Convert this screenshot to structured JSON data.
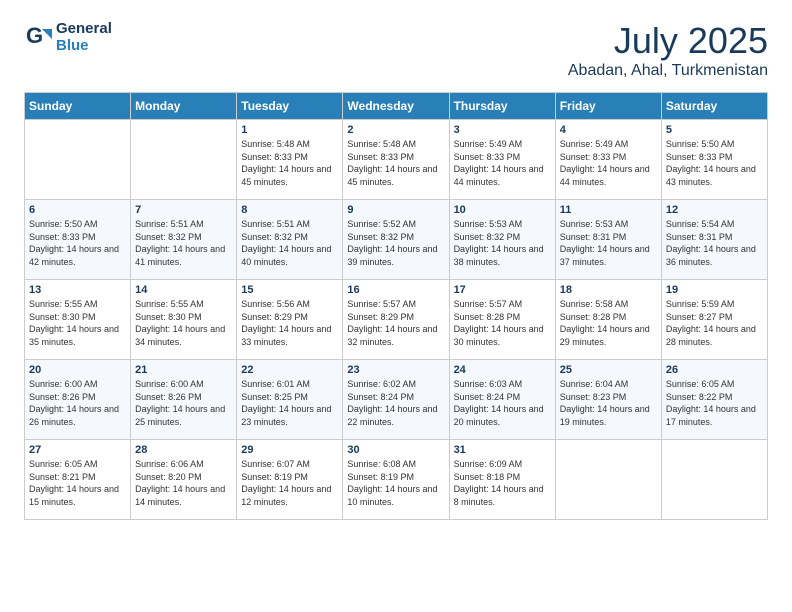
{
  "header": {
    "logo_line1": "General",
    "logo_line2": "Blue",
    "month": "July 2025",
    "location": "Abadan, Ahal, Turkmenistan"
  },
  "days_of_week": [
    "Sunday",
    "Monday",
    "Tuesday",
    "Wednesday",
    "Thursday",
    "Friday",
    "Saturday"
  ],
  "weeks": [
    [
      {
        "day": "",
        "info": ""
      },
      {
        "day": "",
        "info": ""
      },
      {
        "day": "1",
        "info": "Sunrise: 5:48 AM\nSunset: 8:33 PM\nDaylight: 14 hours and 45 minutes."
      },
      {
        "day": "2",
        "info": "Sunrise: 5:48 AM\nSunset: 8:33 PM\nDaylight: 14 hours and 45 minutes."
      },
      {
        "day": "3",
        "info": "Sunrise: 5:49 AM\nSunset: 8:33 PM\nDaylight: 14 hours and 44 minutes."
      },
      {
        "day": "4",
        "info": "Sunrise: 5:49 AM\nSunset: 8:33 PM\nDaylight: 14 hours and 44 minutes."
      },
      {
        "day": "5",
        "info": "Sunrise: 5:50 AM\nSunset: 8:33 PM\nDaylight: 14 hours and 43 minutes."
      }
    ],
    [
      {
        "day": "6",
        "info": "Sunrise: 5:50 AM\nSunset: 8:33 PM\nDaylight: 14 hours and 42 minutes."
      },
      {
        "day": "7",
        "info": "Sunrise: 5:51 AM\nSunset: 8:32 PM\nDaylight: 14 hours and 41 minutes."
      },
      {
        "day": "8",
        "info": "Sunrise: 5:51 AM\nSunset: 8:32 PM\nDaylight: 14 hours and 40 minutes."
      },
      {
        "day": "9",
        "info": "Sunrise: 5:52 AM\nSunset: 8:32 PM\nDaylight: 14 hours and 39 minutes."
      },
      {
        "day": "10",
        "info": "Sunrise: 5:53 AM\nSunset: 8:32 PM\nDaylight: 14 hours and 38 minutes."
      },
      {
        "day": "11",
        "info": "Sunrise: 5:53 AM\nSunset: 8:31 PM\nDaylight: 14 hours and 37 minutes."
      },
      {
        "day": "12",
        "info": "Sunrise: 5:54 AM\nSunset: 8:31 PM\nDaylight: 14 hours and 36 minutes."
      }
    ],
    [
      {
        "day": "13",
        "info": "Sunrise: 5:55 AM\nSunset: 8:30 PM\nDaylight: 14 hours and 35 minutes."
      },
      {
        "day": "14",
        "info": "Sunrise: 5:55 AM\nSunset: 8:30 PM\nDaylight: 14 hours and 34 minutes."
      },
      {
        "day": "15",
        "info": "Sunrise: 5:56 AM\nSunset: 8:29 PM\nDaylight: 14 hours and 33 minutes."
      },
      {
        "day": "16",
        "info": "Sunrise: 5:57 AM\nSunset: 8:29 PM\nDaylight: 14 hours and 32 minutes."
      },
      {
        "day": "17",
        "info": "Sunrise: 5:57 AM\nSunset: 8:28 PM\nDaylight: 14 hours and 30 minutes."
      },
      {
        "day": "18",
        "info": "Sunrise: 5:58 AM\nSunset: 8:28 PM\nDaylight: 14 hours and 29 minutes."
      },
      {
        "day": "19",
        "info": "Sunrise: 5:59 AM\nSunset: 8:27 PM\nDaylight: 14 hours and 28 minutes."
      }
    ],
    [
      {
        "day": "20",
        "info": "Sunrise: 6:00 AM\nSunset: 8:26 PM\nDaylight: 14 hours and 26 minutes."
      },
      {
        "day": "21",
        "info": "Sunrise: 6:00 AM\nSunset: 8:26 PM\nDaylight: 14 hours and 25 minutes."
      },
      {
        "day": "22",
        "info": "Sunrise: 6:01 AM\nSunset: 8:25 PM\nDaylight: 14 hours and 23 minutes."
      },
      {
        "day": "23",
        "info": "Sunrise: 6:02 AM\nSunset: 8:24 PM\nDaylight: 14 hours and 22 minutes."
      },
      {
        "day": "24",
        "info": "Sunrise: 6:03 AM\nSunset: 8:24 PM\nDaylight: 14 hours and 20 minutes."
      },
      {
        "day": "25",
        "info": "Sunrise: 6:04 AM\nSunset: 8:23 PM\nDaylight: 14 hours and 19 minutes."
      },
      {
        "day": "26",
        "info": "Sunrise: 6:05 AM\nSunset: 8:22 PM\nDaylight: 14 hours and 17 minutes."
      }
    ],
    [
      {
        "day": "27",
        "info": "Sunrise: 6:05 AM\nSunset: 8:21 PM\nDaylight: 14 hours and 15 minutes."
      },
      {
        "day": "28",
        "info": "Sunrise: 6:06 AM\nSunset: 8:20 PM\nDaylight: 14 hours and 14 minutes."
      },
      {
        "day": "29",
        "info": "Sunrise: 6:07 AM\nSunset: 8:19 PM\nDaylight: 14 hours and 12 minutes."
      },
      {
        "day": "30",
        "info": "Sunrise: 6:08 AM\nSunset: 8:19 PM\nDaylight: 14 hours and 10 minutes."
      },
      {
        "day": "31",
        "info": "Sunrise: 6:09 AM\nSunset: 8:18 PM\nDaylight: 14 hours and 8 minutes."
      },
      {
        "day": "",
        "info": ""
      },
      {
        "day": "",
        "info": ""
      }
    ]
  ]
}
